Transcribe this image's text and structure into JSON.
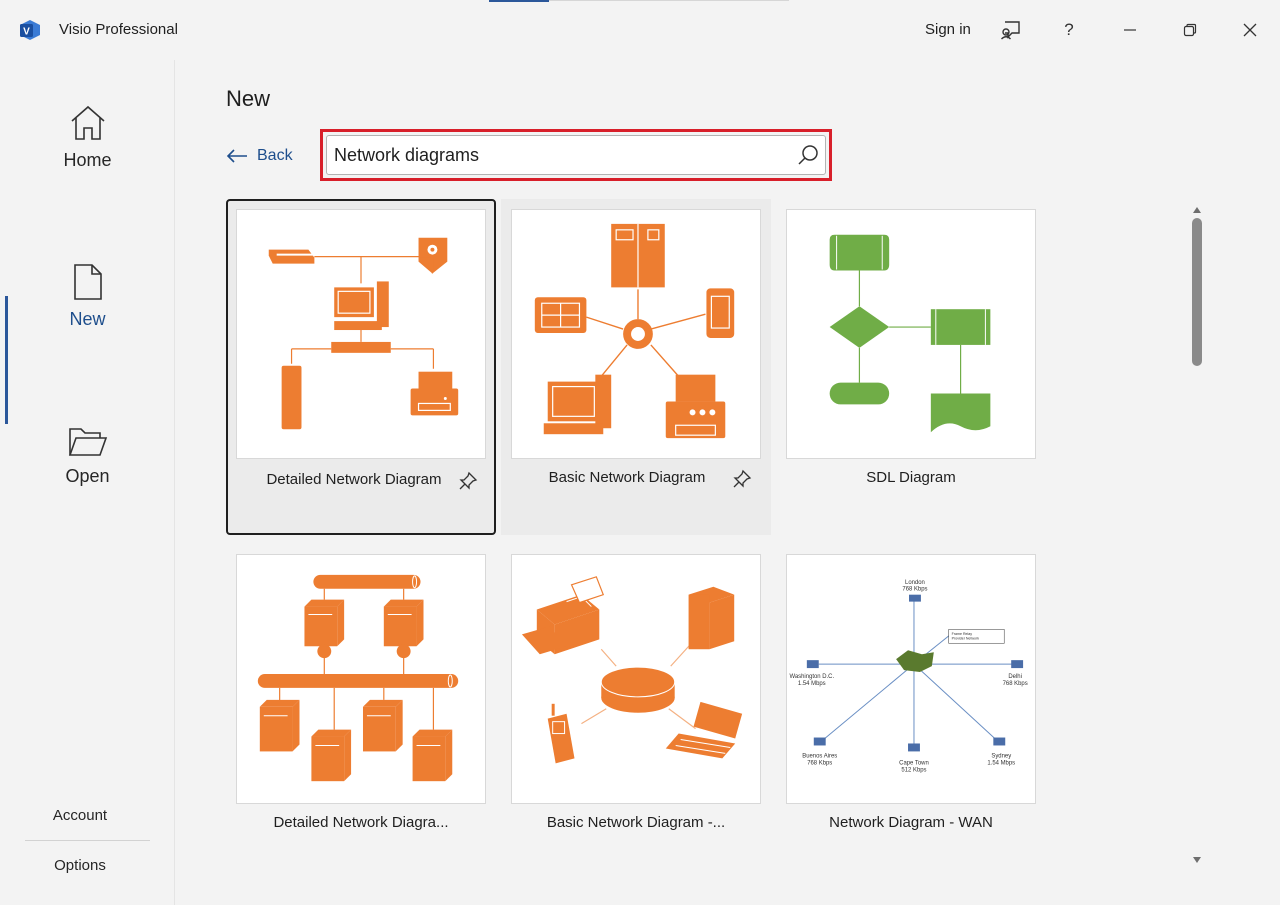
{
  "titlebar": {
    "app_title": "Visio Professional",
    "sign_in": "Sign in",
    "help": "?"
  },
  "sidebar": {
    "items": [
      {
        "label": "Home",
        "icon": "home-icon"
      },
      {
        "label": "New",
        "icon": "new-document-icon",
        "active": true
      },
      {
        "label": "Open",
        "icon": "folder-open-icon"
      }
    ],
    "bottom": [
      {
        "label": "Account"
      },
      {
        "label": "Options"
      }
    ]
  },
  "main": {
    "title": "New",
    "back_label": "Back",
    "search": {
      "value": "Network diagrams",
      "icon": "search-icon"
    },
    "templates": [
      {
        "label": "Detailed Network Diagram",
        "pinned": true,
        "selected": true
      },
      {
        "label": "Basic Network Diagram",
        "pinned": true,
        "hover": true
      },
      {
        "label": "SDL Diagram"
      },
      {
        "label": "Detailed Network Diagra..."
      },
      {
        "label": "Basic Network Diagram -..."
      },
      {
        "label": "Network Diagram - WAN"
      }
    ],
    "wan_thumbnail": {
      "nodes": [
        {
          "name": "London",
          "speed": "768 Kbps"
        },
        {
          "name": "Washington D.C.",
          "speed": "1.54 Mbps"
        },
        {
          "name": "Delhi",
          "speed": "768 Kbps"
        },
        {
          "name": "Buenos Aires",
          "speed": "768 Kbps"
        },
        {
          "name": "Cape Town",
          "speed": "512 Kbps"
        },
        {
          "name": "Sydney",
          "speed": "1.54 Mbps"
        }
      ],
      "callout_line1": "Frame Relay",
      "callout_line2": "Provider Network"
    }
  },
  "colors": {
    "accent": "#2b579a",
    "orange": "#ed7d31",
    "green": "#70ad47",
    "highlight": "#d81f2a"
  }
}
